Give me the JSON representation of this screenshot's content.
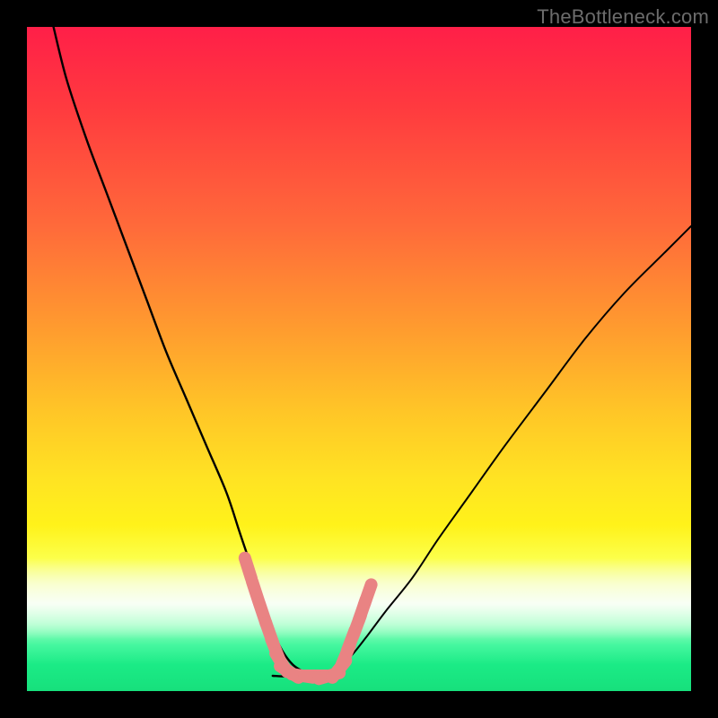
{
  "watermark": {
    "text": "TheBottleneck.com"
  },
  "colors": {
    "black": "#000000",
    "curve": "#000000",
    "marker": "#e98383",
    "watermark": "#6c6c6c"
  },
  "chart_data": {
    "type": "line",
    "title": "",
    "xlabel": "",
    "ylabel": "",
    "xlim": [
      0,
      100
    ],
    "ylim": [
      0,
      100
    ],
    "grid": false,
    "legend": false,
    "series": [
      {
        "name": "left-branch",
        "x": [
          4,
          6,
          9,
          12,
          15,
          18,
          21,
          24,
          27,
          30,
          32,
          34,
          35.5,
          37,
          38.5,
          40,
          41.5,
          43
        ],
        "values": [
          100,
          92,
          83,
          75,
          67,
          59,
          51,
          44,
          37,
          30,
          24,
          18,
          13,
          9,
          6,
          4,
          3,
          2.5
        ]
      },
      {
        "name": "valley-floor",
        "x": [
          37,
          39,
          41,
          43,
          45,
          47
        ],
        "values": [
          2.3,
          2.2,
          2.2,
          2.2,
          2.2,
          2.3
        ]
      },
      {
        "name": "right-branch",
        "x": [
          45,
          47,
          49,
          51,
          54,
          58,
          62,
          67,
          72,
          78,
          84,
          90,
          96,
          100
        ],
        "values": [
          2.5,
          3.5,
          5.5,
          8,
          12,
          17,
          23,
          30,
          37,
          45,
          53,
          60,
          66,
          70
        ]
      }
    ],
    "markers": {
      "name": "threshold-zone",
      "color": "#e98383",
      "shape": "rounded-dash",
      "points": [
        {
          "x": 33.3,
          "y": 18.5
        },
        {
          "x": 34.4,
          "y": 15.0
        },
        {
          "x": 35.5,
          "y": 11.7
        },
        {
          "x": 36.5,
          "y": 8.8
        },
        {
          "x": 37.4,
          "y": 6.3
        },
        {
          "x": 38.3,
          "y": 4.3
        },
        {
          "x": 39.5,
          "y": 2.9
        },
        {
          "x": 41.5,
          "y": 2.3
        },
        {
          "x": 43.5,
          "y": 2.3
        },
        {
          "x": 45.5,
          "y": 2.3
        },
        {
          "x": 47.0,
          "y": 3.3
        },
        {
          "x": 48.0,
          "y": 5.4
        },
        {
          "x": 48.8,
          "y": 7.6
        },
        {
          "x": 49.7,
          "y": 9.9
        },
        {
          "x": 50.5,
          "y": 12.2
        },
        {
          "x": 51.3,
          "y": 14.5
        }
      ]
    }
  }
}
